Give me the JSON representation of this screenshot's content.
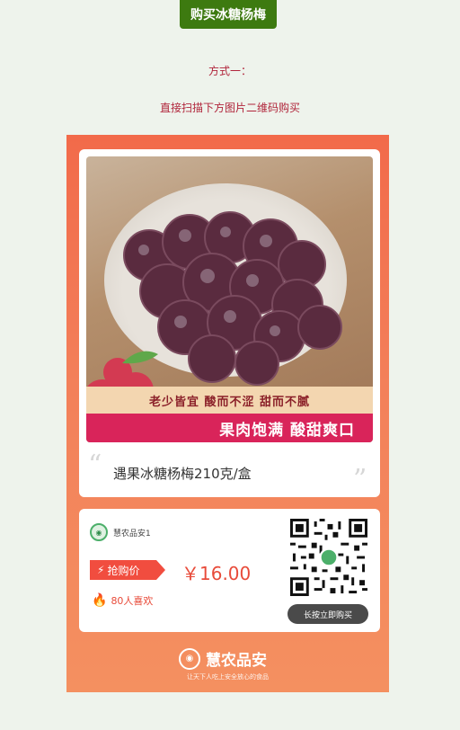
{
  "header": {
    "buy_button_label": "购买冰糖杨梅"
  },
  "instructions": {
    "method_label": "方式一：",
    "method_desc": "直接扫描下方图片二维码购买"
  },
  "poster": {
    "tagline_top": "老少皆宜  酸而不涩  甜而不腻",
    "tagline_bottom": "果肉饱满  酸甜爽口",
    "product_name": "遇果冰糖杨梅210克/盒",
    "shop_name": "慧农品安1",
    "price_badge": "抢购价",
    "price": "￥16.00",
    "likes": "80人喜欢",
    "buy_prompt": "长按立即购买",
    "brand": "慧农品安",
    "slogan": "让天下人吃上安全放心的食品"
  },
  "colors": {
    "accent_green": "#3d7a10",
    "method_red": "#b0243a",
    "poster_orange": "#f26a4a",
    "price_red": "#e84b3a"
  }
}
